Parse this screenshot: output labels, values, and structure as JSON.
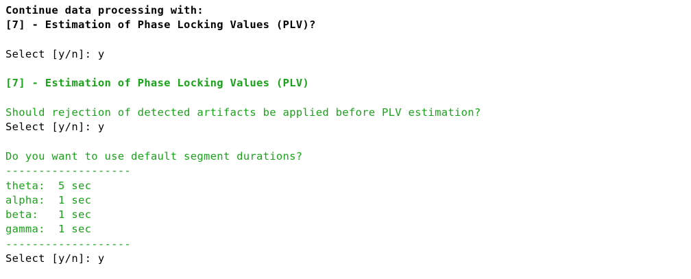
{
  "terminal": {
    "lines": [
      {
        "text": "Continue data processing with:",
        "color": "black",
        "bold": true
      },
      {
        "text": "[7] - Estimation of Phase Locking Values (PLV)?",
        "color": "black",
        "bold": true
      },
      {
        "text": "",
        "color": "black",
        "bold": false
      },
      {
        "text": "Select [y/n]: y",
        "color": "black",
        "bold": false
      },
      {
        "text": "",
        "color": "black",
        "bold": false
      },
      {
        "text": "[7] - Estimation of Phase Locking Values (PLV)",
        "color": "green",
        "bold": true
      },
      {
        "text": "",
        "color": "black",
        "bold": false
      },
      {
        "text": "Should rejection of detected artifacts be applied before PLV estimation?",
        "color": "green",
        "bold": false
      },
      {
        "text": "Select [y/n]: y",
        "color": "black",
        "bold": false
      },
      {
        "text": "",
        "color": "black",
        "bold": false
      },
      {
        "text": "Do you want to use default segment durations?",
        "color": "green",
        "bold": false
      },
      {
        "text": "-------------------",
        "color": "green",
        "bold": false
      },
      {
        "text": "theta:  5 sec",
        "color": "green",
        "bold": false
      },
      {
        "text": "alpha:  1 sec",
        "color": "green",
        "bold": false
      },
      {
        "text": "beta:   1 sec",
        "color": "green",
        "bold": false
      },
      {
        "text": "gamma:  1 sec",
        "color": "green",
        "bold": false
      },
      {
        "text": "-------------------",
        "color": "green",
        "bold": false
      },
      {
        "text": "Select [y/n]: y",
        "color": "black",
        "bold": false
      }
    ]
  },
  "colors": {
    "text": "#000000",
    "accent": "#1aa31a",
    "background": "#ffffff"
  }
}
